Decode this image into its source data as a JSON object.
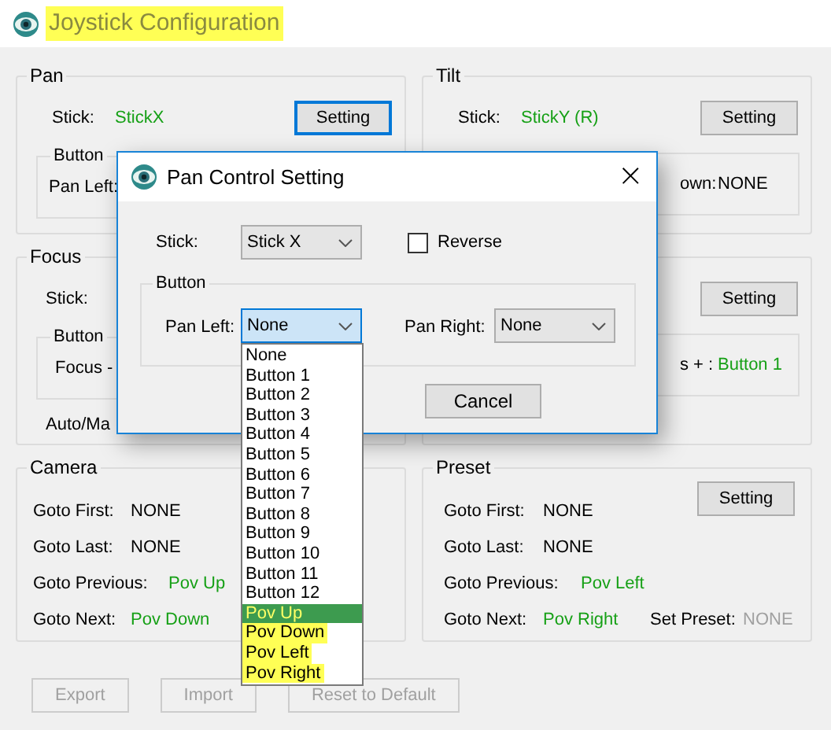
{
  "window": {
    "title": "Joystick Configuration",
    "title_highlighted": true
  },
  "pan": {
    "title": "Pan",
    "stick_label": "Stick:",
    "stick_value": "StickX",
    "setting_button": {
      "label": "Setting",
      "focused": true
    },
    "button_group": {
      "title": "Button",
      "label": "Pan Left:"
    }
  },
  "tilt": {
    "title": "Tilt",
    "stick_label": "Stick:",
    "stick_value": "StickY (R)",
    "setting_button": {
      "label": "Setting",
      "focused": false
    },
    "button_group": {
      "label": "own:",
      "value": "NONE",
      "assigned": false
    }
  },
  "focus": {
    "title": "Focus",
    "stick_label": "Stick:",
    "button_group": {
      "title": "Button",
      "label": "Focus -"
    },
    "mode_label": "Auto/Ma"
  },
  "right_group": {
    "setting_button": {
      "label": "Setting",
      "focused": false
    },
    "button_group": {
      "label": "s + :",
      "value": "Button 1",
      "assigned": true
    }
  },
  "camera": {
    "title": "Camera",
    "rows": [
      {
        "label": "Goto First:",
        "value": "NONE",
        "assigned": false
      },
      {
        "label": "Goto Last:",
        "value": "NONE",
        "assigned": false
      },
      {
        "label": "Goto Previous:",
        "value": "Pov Up",
        "assigned": true
      },
      {
        "label": "Goto Next:",
        "value": "Pov Down",
        "assigned": true
      }
    ]
  },
  "preset": {
    "title": "Preset",
    "setting_button": {
      "label": "Setting",
      "focused": false
    },
    "rows": [
      {
        "label": "Goto First:",
        "value": "NONE",
        "assigned": false
      },
      {
        "label": "Goto Last:",
        "value": "NONE",
        "assigned": false
      },
      {
        "label": "Goto Previous:",
        "value": "Pov Left",
        "assigned": true
      },
      {
        "label": "Goto Next:",
        "value": "Pov Right",
        "assigned": true
      }
    ],
    "set_preset": {
      "label": "Set Preset:",
      "value": "NONE",
      "disabled": true
    }
  },
  "footer_buttons": [
    {
      "label": "Export",
      "disabled": true
    },
    {
      "label": "Import",
      "disabled": true
    },
    {
      "label": "Reset to Default",
      "disabled": true
    }
  ],
  "dialog": {
    "title": "Pan Control Setting",
    "close": "×",
    "stick_label": "Stick:",
    "stick_value": "Stick X",
    "reverse": {
      "label": "Reverse",
      "checked": false
    },
    "button_group": {
      "title": "Button",
      "left_label": "Pan Left:",
      "left_value": "None",
      "right_label": "Pan Right:",
      "right_value": "None"
    },
    "cancel": "Cancel"
  },
  "dropdown": {
    "items": [
      {
        "label": "None",
        "selected": false,
        "highlighted": false
      },
      {
        "label": "Button 1",
        "selected": false,
        "highlighted": false
      },
      {
        "label": "Button 2",
        "selected": false,
        "highlighted": false
      },
      {
        "label": "Button 3",
        "selected": false,
        "highlighted": false
      },
      {
        "label": "Button 4",
        "selected": false,
        "highlighted": false
      },
      {
        "label": "Button 5",
        "selected": false,
        "highlighted": false
      },
      {
        "label": "Button 6",
        "selected": false,
        "highlighted": false
      },
      {
        "label": "Button 7",
        "selected": false,
        "highlighted": false
      },
      {
        "label": "Button 8",
        "selected": false,
        "highlighted": false
      },
      {
        "label": "Button 9",
        "selected": false,
        "highlighted": false
      },
      {
        "label": "Button 10",
        "selected": false,
        "highlighted": false
      },
      {
        "label": "Button 11",
        "selected": false,
        "highlighted": false
      },
      {
        "label": "Button 12",
        "selected": false,
        "highlighted": false
      },
      {
        "label": "Pov Up",
        "selected": true,
        "highlighted": true
      },
      {
        "label": "Pov Down",
        "selected": false,
        "highlighted": true
      },
      {
        "label": "Pov Left",
        "selected": false,
        "highlighted": true
      },
      {
        "label": "Pov Right",
        "selected": false,
        "highlighted": true
      }
    ]
  }
}
